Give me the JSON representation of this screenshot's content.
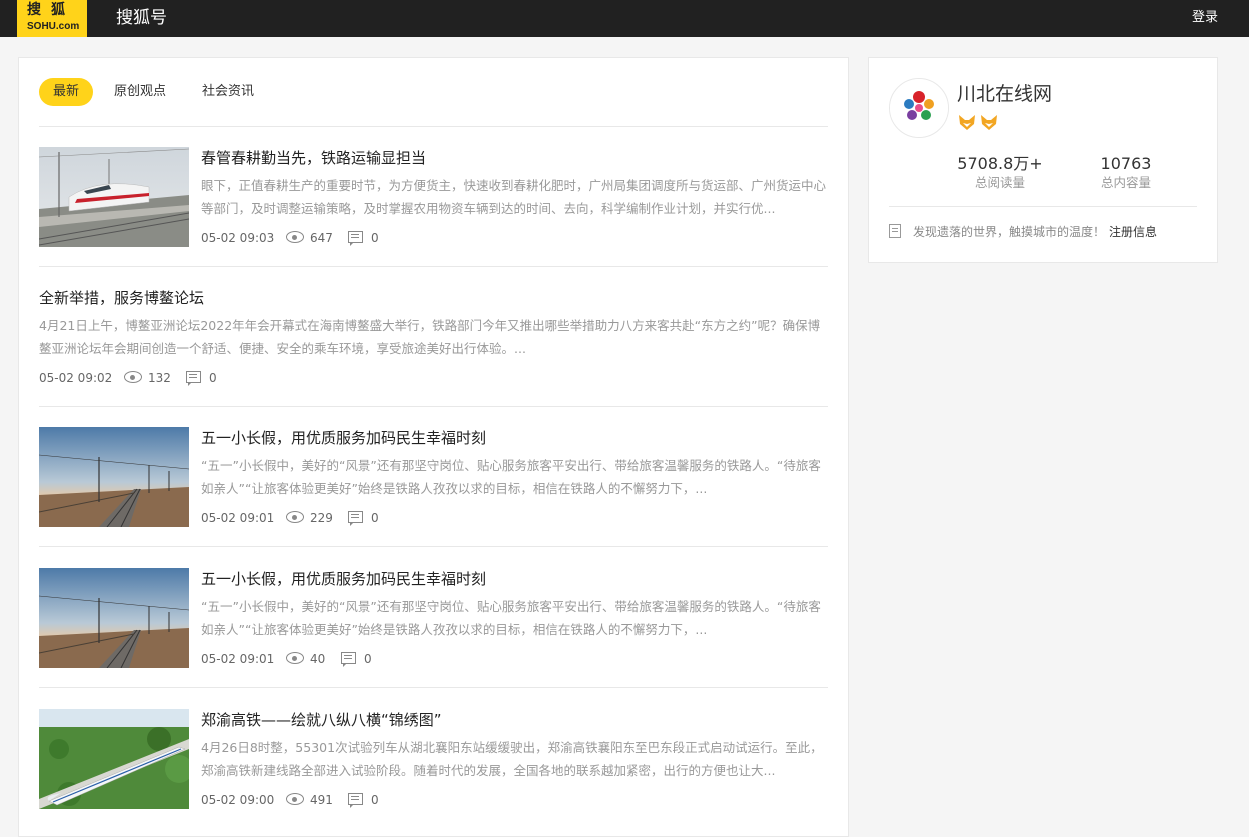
{
  "header": {
    "logo_cn": "搜狐",
    "logo_en": "SOHU.com",
    "site_name": "搜狐号",
    "login": "登录"
  },
  "tabs": [
    {
      "label": "最新",
      "active": true
    },
    {
      "label": "原创观点",
      "active": false
    },
    {
      "label": "社会资讯",
      "active": false
    }
  ],
  "articles": [
    {
      "title": "春管春耕勤当先，铁路运输显担当",
      "desc": "眼下，正值春耕生产的重要时节，为方便货主，快速收到春耕化肥时，广州局集团调度所与货运部、广州货运中心等部门，及时调整运输策略，及时掌握农用物资车辆到达的时间、去向，科学编制作业计划，并实行优...",
      "time": "05-02 09:03",
      "views": "647",
      "comments": "0",
      "thumb": "high-speed-train-red"
    },
    {
      "title": "全新举措，服务博鳌论坛",
      "desc": "4月21日上午，博鳌亚洲论坛2022年年会开幕式在海南博鳌盛大举行，铁路部门今年又推出哪些举措助力八方来客共赴“东方之约”呢？确保博鳌亚洲论坛年会期间创造一个舒适、便捷、安全的乘车环境，享受旅途美好出行体验。...",
      "time": "05-02 09:02",
      "views": "132",
      "comments": "0",
      "thumb": ""
    },
    {
      "title": "五一小长假，用优质服务加码民生幸福时刻",
      "desc": "“五一”小长假中，美好的“风景”还有那坚守岗位、贴心服务旅客平安出行、带给旅客温馨服务的铁路人。“待旅客如亲人”“让旅客体验更美好”始终是铁路人孜孜以求的目标，相信在铁路人的不懈努力下，...",
      "time": "05-02 09:01",
      "views": "229",
      "comments": "0",
      "thumb": "railway-tracks-sunset"
    },
    {
      "title": "五一小长假，用优质服务加码民生幸福时刻",
      "desc": "“五一”小长假中，美好的“风景”还有那坚守岗位、贴心服务旅客平安出行、带给旅客温馨服务的铁路人。“待旅客如亲人”“让旅客体验更美好”始终是铁路人孜孜以求的目标，相信在铁路人的不懈努力下，...",
      "time": "05-02 09:01",
      "views": "40",
      "comments": "0",
      "thumb": "railway-tracks-sunset"
    },
    {
      "title": "郑渝高铁——绘就八纵八横“锦绣图”",
      "desc": "4月26日8时整，55301次试验列车从湖北襄阳东站缓缓驶出，郑渝高铁襄阳东至巴东段正式启动试运行。至此，郑渝高铁新建线路全部进入试验阶段。随着时代的发展，全国各地的联系越加紧密，出行的方便也让大...",
      "time": "05-02 09:00",
      "views": "491",
      "comments": "0",
      "thumb": "white-train-bridge"
    }
  ],
  "profile": {
    "name": "川北在线网",
    "badge_icon": "fox-badge-icon",
    "stats": [
      {
        "value": "5708.8万+",
        "label": "总阅读量"
      },
      {
        "value": "10763",
        "label": "总内容量"
      }
    ],
    "intro": "发现遗落的世界，触摸城市的温度！",
    "register_link": "注册信息"
  }
}
